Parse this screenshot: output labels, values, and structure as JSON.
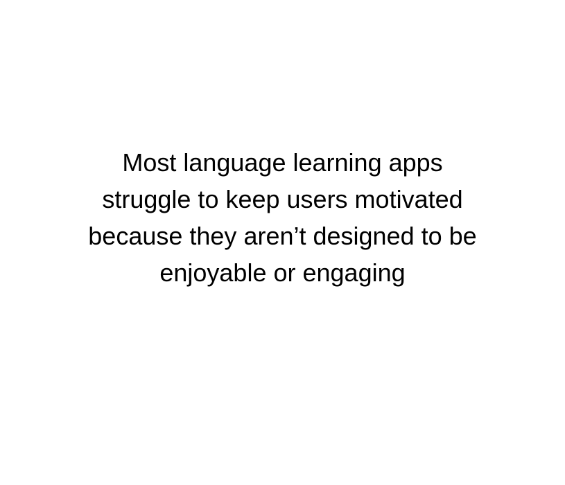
{
  "statement": {
    "lines": [
      "Most language learning apps",
      "struggle to keep users motivated",
      "because they aren’t designed to be",
      "enjoyable or engaging"
    ]
  },
  "colors": {
    "background": "#ffffff",
    "text": "#000000"
  }
}
